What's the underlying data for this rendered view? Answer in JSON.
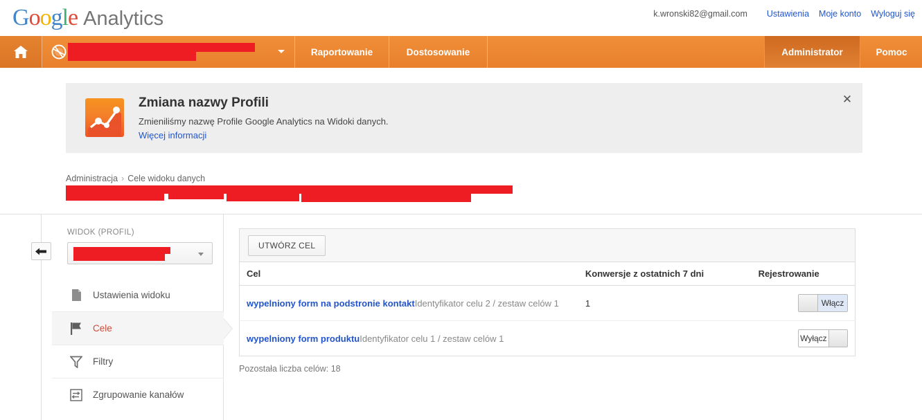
{
  "brand": {
    "google": "Google",
    "product": "Analytics"
  },
  "account_bar": {
    "email": "k.wronski82@gmail.com",
    "links": [
      {
        "label": "Ustawienia"
      },
      {
        "label": "Moje konto"
      },
      {
        "label": "Wyloguj się"
      }
    ]
  },
  "navbar": {
    "home_icon": "home-icon",
    "globe_icon": "globe-icon",
    "property_selector": "redacted",
    "tabs": [
      {
        "label": "Raportowanie",
        "active": false
      },
      {
        "label": "Dostosowanie",
        "active": false
      },
      {
        "label": "Administrator",
        "active": true
      },
      {
        "label": "Pomoc",
        "active": false
      }
    ]
  },
  "banner": {
    "icon": "analytics-chart-icon",
    "title": "Zmiana nazwy Profili",
    "subtitle": "Zmieniliśmy nazwę Profile Google Analytics na Widoki danych.",
    "link": "Więcej informacji",
    "close_icon": "close-icon"
  },
  "breadcrumb": {
    "items": [
      "Administracja",
      "Cele widoku danych"
    ],
    "separator": "›",
    "page_title": "redacted"
  },
  "sidebar": {
    "collapse_icon": "arrow-left-icon",
    "section_label": "WIDOK (PROFIL)",
    "view_selector_value": "redacted",
    "items": [
      {
        "label": "Ustawienia widoku",
        "icon": "document-icon",
        "active": false
      },
      {
        "label": "Cele",
        "icon": "flag-icon",
        "active": true
      },
      {
        "label": "Filtry",
        "icon": "funnel-icon",
        "active": false
      },
      {
        "label": "Zgrupowanie kanałów",
        "icon": "channel-grouping-icon",
        "active": false
      }
    ]
  },
  "main": {
    "create_goal_button": "UTWÓRZ CEL",
    "table": {
      "headers": {
        "goal": "Cel",
        "conversions": "Konwersje z ostatnich 7 dni",
        "recording": "Rejestrowanie"
      },
      "rows": [
        {
          "name": "wypelniony form na podstronie kontakt",
          "meta": "Identyfikator celu 2 / zestaw celów 1",
          "conversions": "1",
          "toggle_label": "Włącz",
          "toggle_state": "on"
        },
        {
          "name": "wypelniony form produktu",
          "meta": "Identyfikator celu 1 / zestaw celów 1",
          "conversions": "",
          "toggle_label": "Wyłącz",
          "toggle_state": "off"
        }
      ]
    },
    "remaining_text": "Pozostała liczba celów: 18"
  },
  "colors": {
    "nav_orange": "#e8802c",
    "nav_orange_active": "#cf6a20",
    "link_blue": "#2255cc",
    "active_red": "#d14836",
    "redaction": "#ee1c23"
  }
}
